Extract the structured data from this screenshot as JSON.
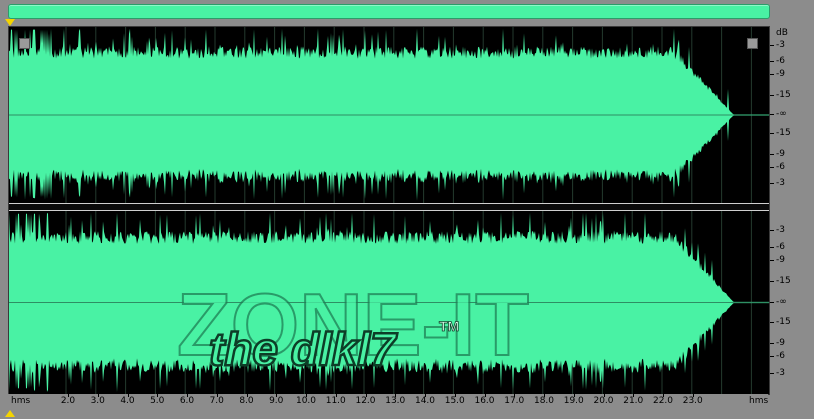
{
  "overview": {
    "color": "#49f2a4"
  },
  "waveform": {
    "color": "#49f2a4",
    "background": "#000000",
    "center_line_color": "#2e8f64"
  },
  "db_scale": {
    "unit": "dB",
    "channel1_labels": [
      "-3",
      "-6",
      "-9",
      "-15",
      "-∞",
      "-15",
      "-9",
      "-6",
      "-3"
    ],
    "channel2_labels": [
      "-3",
      "-6",
      "-9",
      "-15",
      "-∞",
      "-15",
      "-9",
      "-6",
      "-3"
    ]
  },
  "timeline": {
    "unit_left": "hms",
    "unit_right": "hms",
    "labels": [
      "2.0",
      "3.0",
      "4.0",
      "5.0",
      "6.0",
      "7.0",
      "8.0",
      "9.0",
      "10.0",
      "11.0",
      "12.0",
      "13.0",
      "14.0",
      "15.0",
      "16.0",
      "17.0",
      "18.0",
      "19.0",
      "20.0",
      "21.0",
      "22.0",
      "23.0"
    ]
  },
  "watermark": {
    "main": "ZONE-IT",
    "sub": "the dlkl7",
    "mark": "TM"
  }
}
